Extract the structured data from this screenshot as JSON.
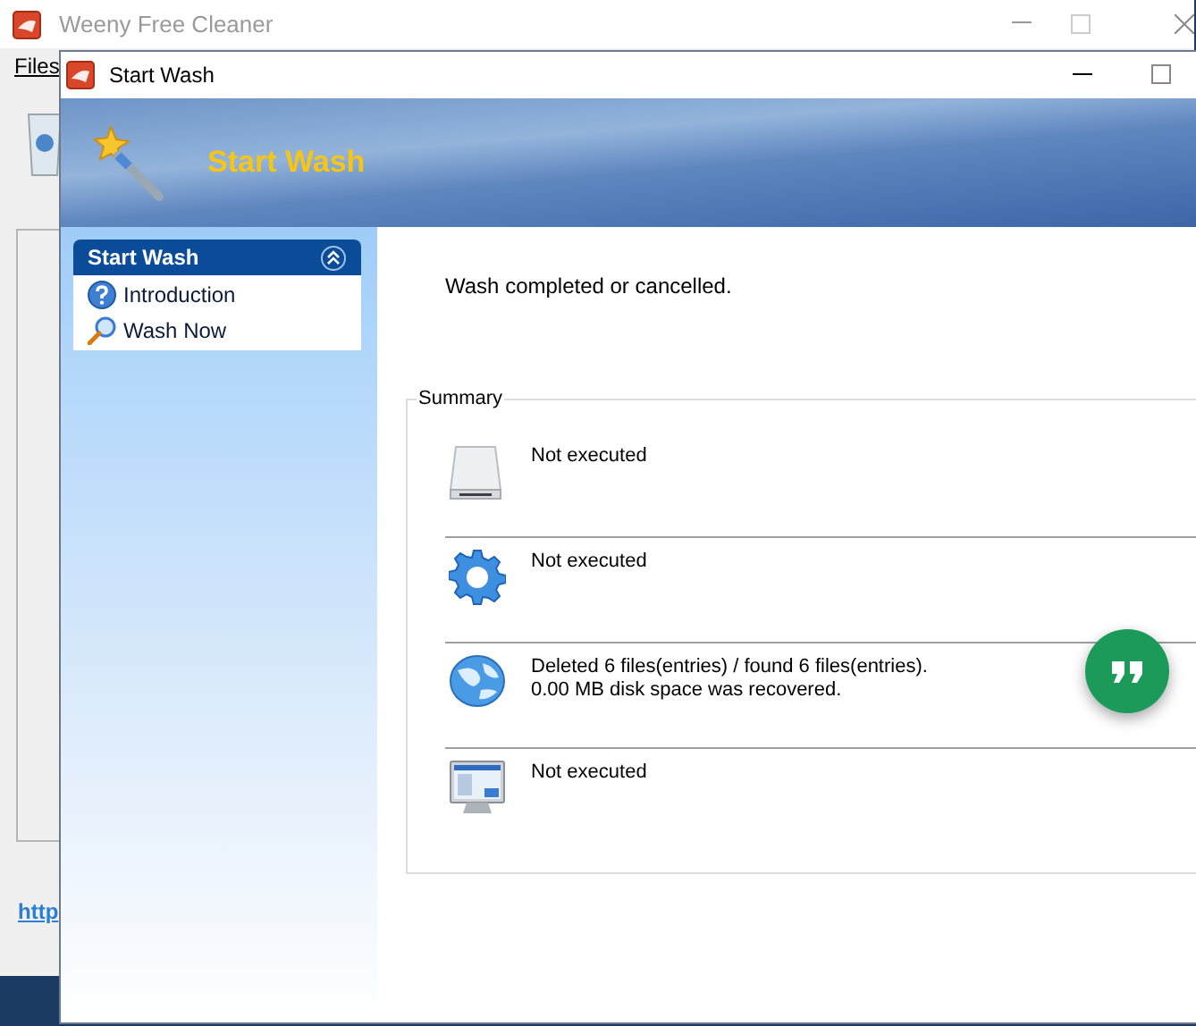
{
  "main_window": {
    "title": "Weeny Free Cleaner",
    "menu": [
      "Files"
    ],
    "link": "http"
  },
  "dialog": {
    "title": "Start Wash",
    "banner_title": "Start Wash",
    "task_panel": {
      "title": "Start Wash",
      "expanded": true,
      "items": [
        {
          "label": "Introduction",
          "kind": "help"
        },
        {
          "label": "Wash Now",
          "kind": "search"
        }
      ]
    },
    "status": "Wash completed or cancelled.",
    "summary": {
      "title": "Summary",
      "rows": [
        {
          "kind": "drive",
          "lines": [
            "Not executed"
          ]
        },
        {
          "kind": "gear",
          "lines": [
            "Not executed"
          ]
        },
        {
          "kind": "globe",
          "lines": [
            "Deleted 6 files(entries) / found 6 files(entries).",
            "0.00 MB disk space was recovered."
          ]
        },
        {
          "kind": "monitor",
          "lines": [
            "Not executed"
          ]
        }
      ]
    }
  }
}
